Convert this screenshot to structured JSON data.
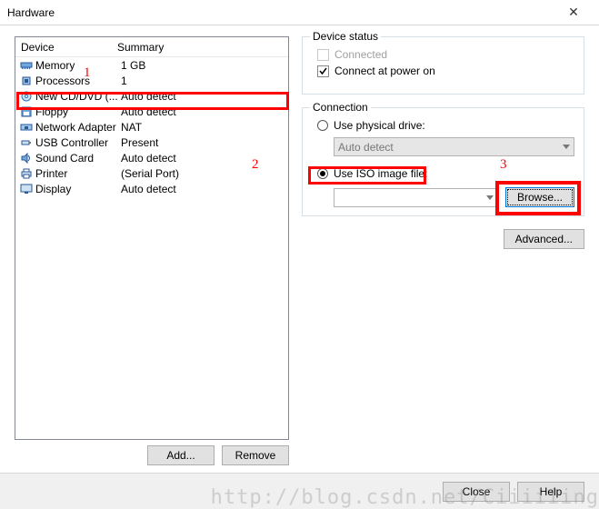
{
  "window": {
    "title": "Hardware"
  },
  "list": {
    "header_device": "Device",
    "header_summary": "Summary",
    "rows": [
      {
        "name": "Memory",
        "summary": "1 GB"
      },
      {
        "name": "Processors",
        "summary": "1"
      },
      {
        "name": "New CD/DVD (...",
        "summary": "Auto detect"
      },
      {
        "name": "Floppy",
        "summary": "Auto detect"
      },
      {
        "name": "Network Adapter",
        "summary": "NAT"
      },
      {
        "name": "USB Controller",
        "summary": "Present"
      },
      {
        "name": "Sound Card",
        "summary": "Auto detect"
      },
      {
        "name": "Printer",
        "summary": "(Serial Port)"
      },
      {
        "name": "Display",
        "summary": "Auto detect"
      }
    ],
    "add_label": "Add...",
    "remove_label": "Remove"
  },
  "status": {
    "legend": "Device status",
    "connected_label": "Connected",
    "poweron_label": "Connect at power on"
  },
  "connection": {
    "legend": "Connection",
    "physical_label": "Use physical drive:",
    "physical_value": "Auto detect",
    "iso_label": "Use ISO image file:",
    "iso_value": "",
    "browse_label": "Browse...",
    "advanced_label": "Advanced..."
  },
  "bottom": {
    "close_label": "Close",
    "help_label": "Help"
  },
  "annotations": {
    "a1": "1",
    "a2": "2",
    "a3": "3"
  },
  "watermark": "http://blog.csdn.net/Ciiiiiing"
}
